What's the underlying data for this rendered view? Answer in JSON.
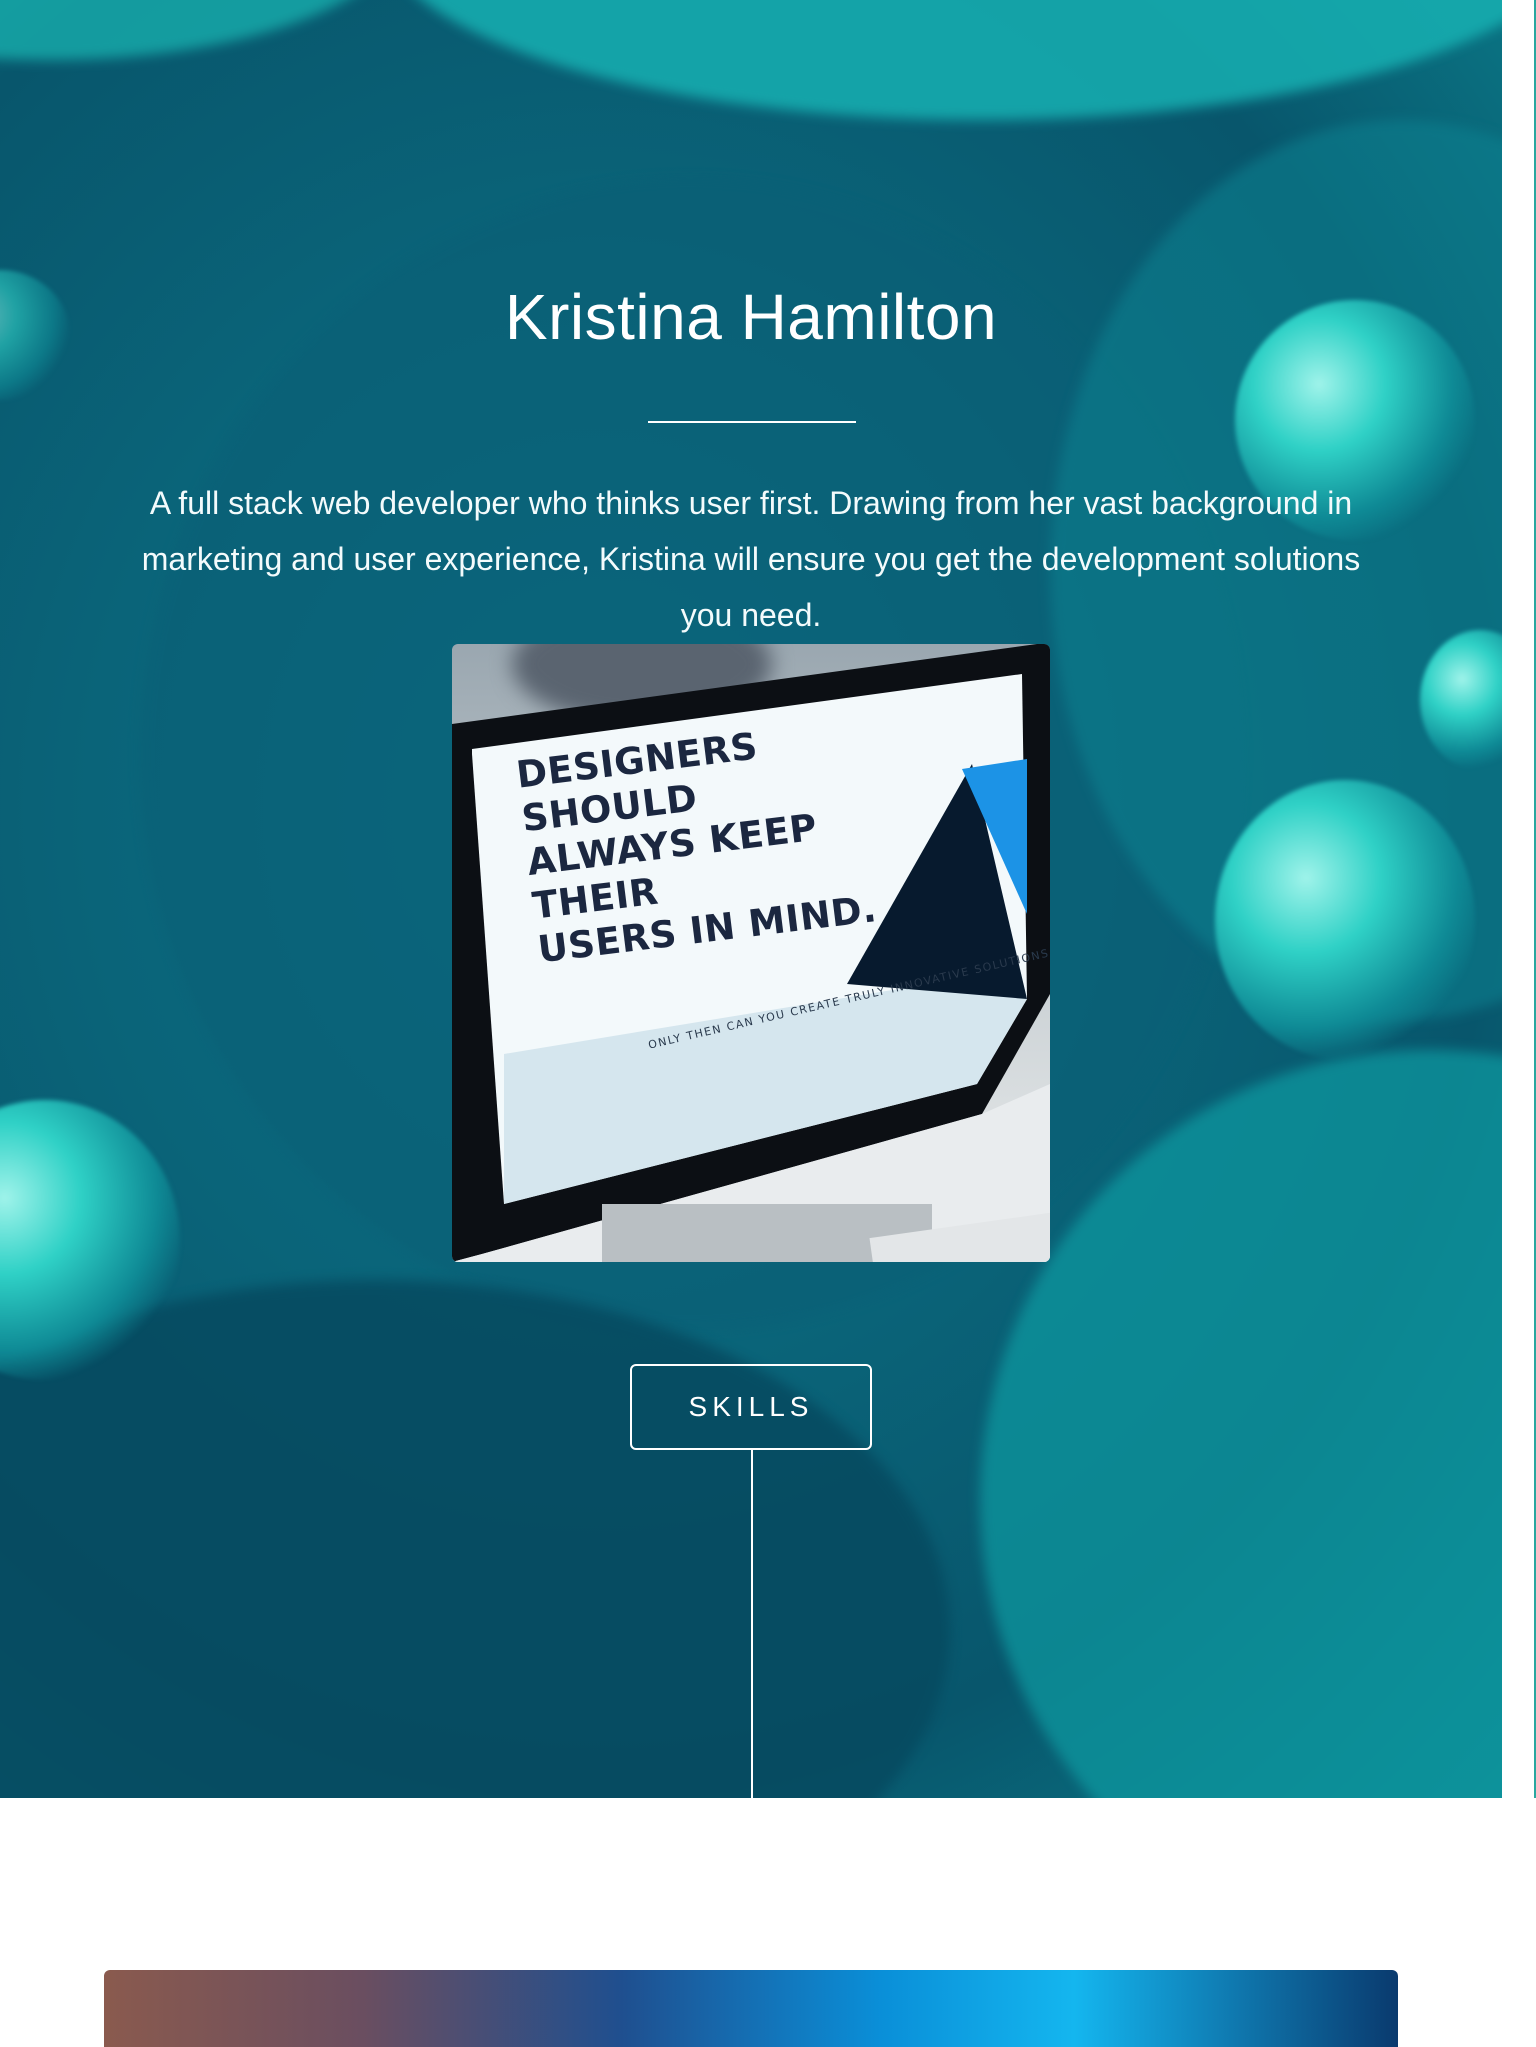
{
  "hero": {
    "name": "Kristina Hamilton",
    "bio": "A full stack web developer who thinks user first. Drawing from her vast background in marketing and user experience, Kristina will ensure you get the development solutions you need.",
    "image": {
      "headline_lines": [
        "DESIGNERS SHOULD",
        "ALWAYS KEEP THEIR",
        "USERS IN MIND."
      ],
      "subline": "ONLY THEN CAN YOU CREATE TRULY INNOVATIVE SOLUTIONS"
    },
    "skills_button": "SKILLS"
  },
  "colors": {
    "hero_bg": "#0a6479",
    "text": "#ffffff",
    "accent_line": "#2aa7a0"
  }
}
